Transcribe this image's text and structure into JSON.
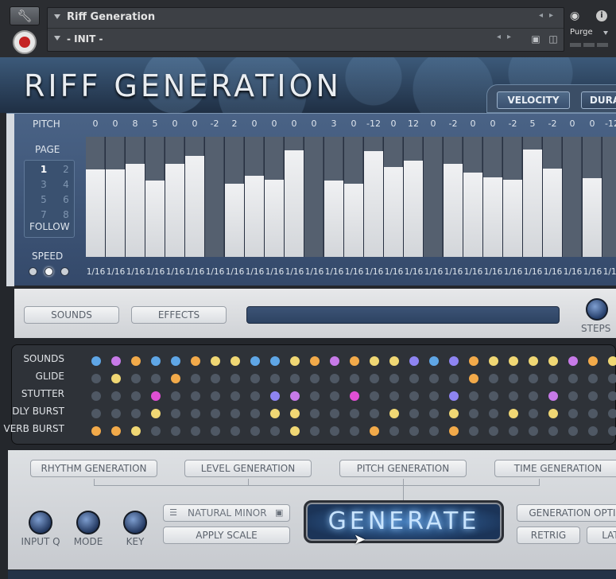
{
  "header": {
    "instrument_name": "Riff Generation",
    "preset_name": "- INIT -",
    "purge_label": "Purge",
    "icons": [
      "wrench-icon",
      "record-icon",
      "camera-icon",
      "info-icon",
      "save-icon",
      "trash-icon",
      "chevron-left-icon",
      "chevron-right-icon"
    ]
  },
  "title": "RIFF GENERATION",
  "tabs": [
    "VELOCITY",
    "DURA"
  ],
  "sequencer": {
    "pitch_label": "PITCH",
    "pitch_values": [
      "0",
      "0",
      "8",
      "5",
      "0",
      "0",
      "-2",
      "2",
      "0",
      "0",
      "0",
      "0",
      "3",
      "0",
      "-12",
      "0",
      "12",
      "0",
      "-2",
      "0",
      "0",
      "-2",
      "5",
      "-2",
      "0",
      "0",
      "-12"
    ],
    "bar_levels": [
      0.78,
      0.78,
      0.83,
      0.68,
      0.83,
      0.9,
      0.0,
      0.65,
      0.72,
      0.69,
      0.95,
      0.0,
      0.68,
      0.65,
      0.94,
      0.8,
      0.86,
      0.0,
      0.83,
      0.75,
      0.71,
      0.69,
      0.96,
      0.79,
      0.0,
      0.7,
      0.0
    ],
    "lengths": [
      "1/16",
      "1/16",
      "1/16",
      "1/16",
      "1/16",
      "1/16",
      "1/16",
      "1/16",
      "1/16",
      "1/16",
      "1/16",
      "1/16",
      "1/16",
      "1/16",
      "1/16",
      "1/16",
      "1/16",
      "1/16",
      "1/16",
      "1/16",
      "1/16",
      "1/16",
      "1/16",
      "1/16",
      "1/16",
      "1/16",
      "1/16"
    ],
    "page_label": "PAGE",
    "pages": [
      "1",
      "2",
      "3",
      "4",
      "5",
      "6",
      "7",
      "8"
    ],
    "active_page": "1",
    "follow_label": "FOLLOW",
    "speed_label": "SPEED"
  },
  "mid_bar": {
    "sounds_label": "SOUNDS",
    "effects_label": "EFFECTS",
    "steps_label": "STEPS"
  },
  "matrix": {
    "rows": [
      "SOUNDS",
      "GLIDE",
      "STUTTER",
      "DLY BURST",
      "VERB BURST"
    ],
    "colors": {
      "b": "#5fa6e6",
      "p": "#c77ae8",
      "o": "#f2aa4a",
      "y": "#f0d774",
      "m": "#e04fd4",
      "v": "#8e84f2",
      "g": "#4f5864"
    },
    "grid": [
      [
        "b",
        "p",
        "o",
        "b",
        "b",
        "o",
        "y",
        "y",
        "b",
        "b",
        "y",
        "o",
        "p",
        "o",
        "y",
        "y",
        "v",
        "b",
        "v",
        "o",
        "y",
        "y",
        "y",
        "y",
        "p",
        "o",
        "y"
      ],
      [
        "g",
        "y",
        "g",
        "g",
        "o",
        "g",
        "g",
        "g",
        "g",
        "g",
        "g",
        "g",
        "g",
        "g",
        "g",
        "g",
        "g",
        "g",
        "g",
        "o",
        "g",
        "g",
        "g",
        "g",
        "g",
        "g",
        "g"
      ],
      [
        "g",
        "g",
        "g",
        "m",
        "g",
        "g",
        "g",
        "g",
        "g",
        "v",
        "p",
        "g",
        "g",
        "m",
        "g",
        "g",
        "g",
        "g",
        "v",
        "g",
        "g",
        "g",
        "g",
        "p",
        "g",
        "g",
        "g"
      ],
      [
        "g",
        "g",
        "g",
        "y",
        "g",
        "g",
        "g",
        "g",
        "g",
        "y",
        "y",
        "g",
        "g",
        "g",
        "g",
        "y",
        "g",
        "g",
        "y",
        "g",
        "g",
        "y",
        "g",
        "y",
        "g",
        "g",
        "g"
      ],
      [
        "o",
        "o",
        "y",
        "g",
        "g",
        "g",
        "g",
        "g",
        "g",
        "g",
        "y",
        "g",
        "g",
        "g",
        "o",
        "g",
        "g",
        "g",
        "o",
        "g",
        "g",
        "g",
        "g",
        "g",
        "g",
        "g",
        "g"
      ]
    ]
  },
  "generation": {
    "rhythm_label": "RHYTHM GENERATION",
    "level_label": "LEVEL GENERATION",
    "pitch_label": "PITCH GENERATION",
    "time_label": "TIME GENERATION",
    "knobs": [
      "INPUT Q",
      "MODE",
      "KEY"
    ],
    "scale_value": "NATURAL MINOR",
    "apply_scale_label": "APPLY SCALE",
    "generate_label": "GENERATE",
    "options_label": "GENERATION OPTI",
    "retrig_label": "RETRIG",
    "lat_label": "LAT"
  }
}
